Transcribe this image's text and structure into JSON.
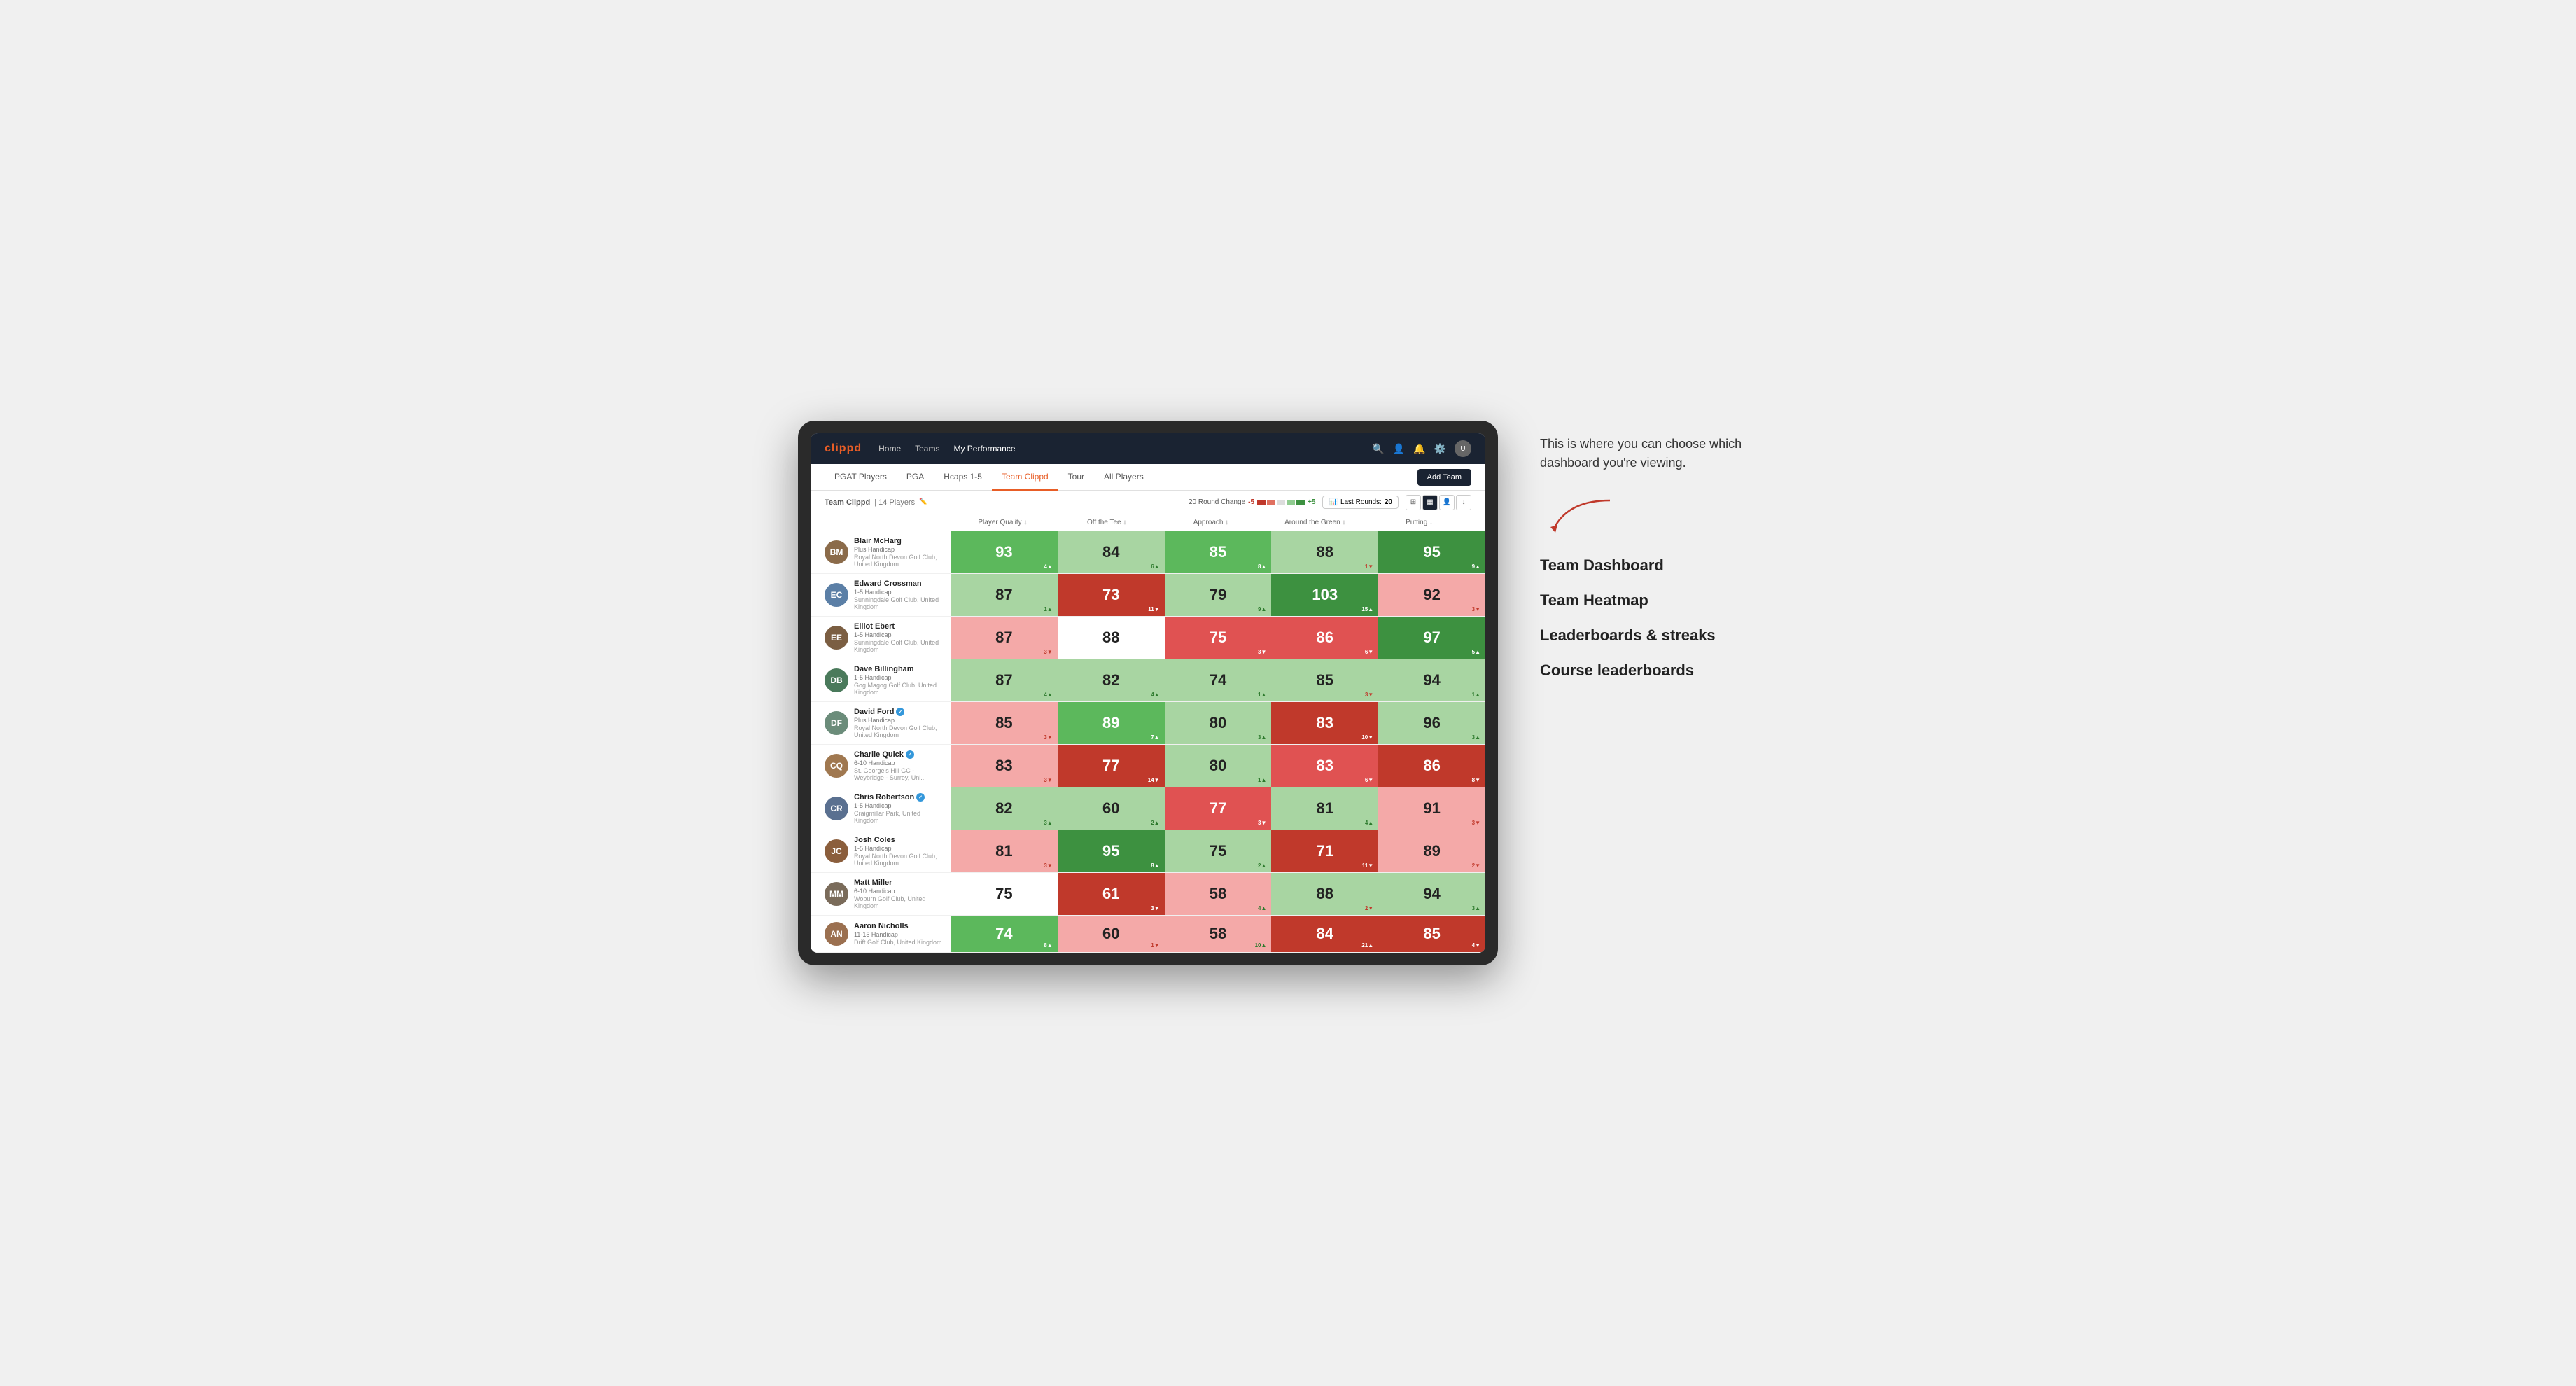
{
  "page": {
    "title": "Team Dashboard"
  },
  "nav": {
    "logo": "clippd",
    "links": [
      "Home",
      "Teams",
      "My Performance"
    ],
    "active_link": "My Performance"
  },
  "tabs": {
    "items": [
      "PGAT Players",
      "PGA",
      "Hcaps 1-5",
      "Team Clippd",
      "Tour",
      "All Players"
    ],
    "active": "Team Clippd",
    "add_button": "Add Team"
  },
  "sub_header": {
    "title": "Team Clippd",
    "player_count": "14 Players",
    "round_change_label": "20 Round Change",
    "round_change_neg": "-5",
    "round_change_pos": "+5",
    "last_rounds_label": "Last Rounds:",
    "last_rounds_value": "20"
  },
  "table": {
    "columns": [
      "Player Quality ↓",
      "Off the Tee ↓",
      "Approach ↓",
      "Around the Green ↓",
      "Putting ↓"
    ],
    "rows": [
      {
        "name": "Blair McHarg",
        "handicap": "Plus Handicap",
        "club": "Royal North Devon Golf Club, United Kingdom",
        "verified": false,
        "initials": "BM",
        "avatar_color": "#8B6B4A",
        "scores": [
          {
            "value": 93,
            "delta": 4,
            "dir": "up",
            "bg": "medium-green"
          },
          {
            "value": 84,
            "delta": 6,
            "dir": "up",
            "bg": "light-green"
          },
          {
            "value": 85,
            "delta": 8,
            "dir": "up",
            "bg": "medium-green"
          },
          {
            "value": 88,
            "delta": 1,
            "dir": "down",
            "bg": "light-green"
          },
          {
            "value": 95,
            "delta": 9,
            "dir": "up",
            "bg": "dark-green"
          }
        ]
      },
      {
        "name": "Edward Crossman",
        "handicap": "1-5 Handicap",
        "club": "Sunningdale Golf Club, United Kingdom",
        "verified": false,
        "initials": "EC",
        "avatar_color": "#5B7FA6",
        "scores": [
          {
            "value": 87,
            "delta": 1,
            "dir": "up",
            "bg": "light-green"
          },
          {
            "value": 73,
            "delta": 11,
            "dir": "down",
            "bg": "dark-red"
          },
          {
            "value": 79,
            "delta": 9,
            "dir": "up",
            "bg": "light-green"
          },
          {
            "value": 103,
            "delta": 15,
            "dir": "up",
            "bg": "dark-green"
          },
          {
            "value": 92,
            "delta": 3,
            "dir": "down",
            "bg": "light-red"
          }
        ]
      },
      {
        "name": "Elliot Ebert",
        "handicap": "1-5 Handicap",
        "club": "Sunningdale Golf Club, United Kingdom",
        "verified": false,
        "initials": "EE",
        "avatar_color": "#7B5E42",
        "scores": [
          {
            "value": 87,
            "delta": 3,
            "dir": "down",
            "bg": "light-red"
          },
          {
            "value": 88,
            "delta": null,
            "dir": null,
            "bg": "white-bg"
          },
          {
            "value": 75,
            "delta": 3,
            "dir": "down",
            "bg": "medium-red"
          },
          {
            "value": 86,
            "delta": 6,
            "dir": "down",
            "bg": "medium-red"
          },
          {
            "value": 97,
            "delta": 5,
            "dir": "up",
            "bg": "dark-green"
          }
        ]
      },
      {
        "name": "Dave Billingham",
        "handicap": "1-5 Handicap",
        "club": "Gog Magog Golf Club, United Kingdom",
        "verified": false,
        "initials": "DB",
        "avatar_color": "#4A7A5B",
        "scores": [
          {
            "value": 87,
            "delta": 4,
            "dir": "up",
            "bg": "light-green"
          },
          {
            "value": 82,
            "delta": 4,
            "dir": "up",
            "bg": "light-green"
          },
          {
            "value": 74,
            "delta": 1,
            "dir": "up",
            "bg": "light-green"
          },
          {
            "value": 85,
            "delta": 3,
            "dir": "down",
            "bg": "light-green"
          },
          {
            "value": 94,
            "delta": 1,
            "dir": "up",
            "bg": "light-green"
          }
        ]
      },
      {
        "name": "David Ford",
        "handicap": "Plus Handicap",
        "club": "Royal North Devon Golf Club, United Kingdom",
        "verified": true,
        "initials": "DF",
        "avatar_color": "#6B8C7A",
        "scores": [
          {
            "value": 85,
            "delta": 3,
            "dir": "down",
            "bg": "light-red"
          },
          {
            "value": 89,
            "delta": 7,
            "dir": "up",
            "bg": "medium-green"
          },
          {
            "value": 80,
            "delta": 3,
            "dir": "up",
            "bg": "light-green"
          },
          {
            "value": 83,
            "delta": 10,
            "dir": "down",
            "bg": "dark-red"
          },
          {
            "value": 96,
            "delta": 3,
            "dir": "up",
            "bg": "light-green"
          }
        ]
      },
      {
        "name": "Charlie Quick",
        "handicap": "6-10 Handicap",
        "club": "St. George's Hill GC - Weybridge - Surrey, Uni...",
        "verified": true,
        "initials": "CQ",
        "avatar_color": "#A07850",
        "scores": [
          {
            "value": 83,
            "delta": 3,
            "dir": "down",
            "bg": "light-red"
          },
          {
            "value": 77,
            "delta": 14,
            "dir": "down",
            "bg": "dark-red"
          },
          {
            "value": 80,
            "delta": 1,
            "dir": "up",
            "bg": "light-green"
          },
          {
            "value": 83,
            "delta": 6,
            "dir": "down",
            "bg": "medium-red"
          },
          {
            "value": 86,
            "delta": 8,
            "dir": "down",
            "bg": "dark-red"
          }
        ]
      },
      {
        "name": "Chris Robertson",
        "handicap": "1-5 Handicap",
        "club": "Craigmillar Park, United Kingdom",
        "verified": true,
        "initials": "CR",
        "avatar_color": "#5A7090",
        "scores": [
          {
            "value": 82,
            "delta": 3,
            "dir": "up",
            "bg": "light-green"
          },
          {
            "value": 60,
            "delta": 2,
            "dir": "up",
            "bg": "light-green"
          },
          {
            "value": 77,
            "delta": 3,
            "dir": "down",
            "bg": "medium-red"
          },
          {
            "value": 81,
            "delta": 4,
            "dir": "up",
            "bg": "light-green"
          },
          {
            "value": 91,
            "delta": 3,
            "dir": "down",
            "bg": "light-red"
          }
        ]
      },
      {
        "name": "Josh Coles",
        "handicap": "1-5 Handicap",
        "club": "Royal North Devon Golf Club, United Kingdom",
        "verified": false,
        "initials": "JC",
        "avatar_color": "#8B5E3C",
        "scores": [
          {
            "value": 81,
            "delta": 3,
            "dir": "down",
            "bg": "light-red"
          },
          {
            "value": 95,
            "delta": 8,
            "dir": "up",
            "bg": "dark-green"
          },
          {
            "value": 75,
            "delta": 2,
            "dir": "up",
            "bg": "light-green"
          },
          {
            "value": 71,
            "delta": 11,
            "dir": "down",
            "bg": "dark-red"
          },
          {
            "value": 89,
            "delta": 2,
            "dir": "down",
            "bg": "light-red"
          }
        ]
      },
      {
        "name": "Matt Miller",
        "handicap": "6-10 Handicap",
        "club": "Woburn Golf Club, United Kingdom",
        "verified": false,
        "initials": "MM",
        "avatar_color": "#7A6B5A",
        "scores": [
          {
            "value": 75,
            "delta": null,
            "dir": null,
            "bg": "white-bg"
          },
          {
            "value": 61,
            "delta": 3,
            "dir": "down",
            "bg": "dark-red"
          },
          {
            "value": 58,
            "delta": 4,
            "dir": "up",
            "bg": "light-red"
          },
          {
            "value": 88,
            "delta": 2,
            "dir": "down",
            "bg": "light-green"
          },
          {
            "value": 94,
            "delta": 3,
            "dir": "up",
            "bg": "light-green"
          }
        ]
      },
      {
        "name": "Aaron Nicholls",
        "handicap": "11-15 Handicap",
        "club": "Drift Golf Club, United Kingdom",
        "verified": false,
        "initials": "AN",
        "avatar_color": "#9B7050",
        "scores": [
          {
            "value": 74,
            "delta": 8,
            "dir": "up",
            "bg": "medium-green"
          },
          {
            "value": 60,
            "delta": 1,
            "dir": "down",
            "bg": "light-red"
          },
          {
            "value": 58,
            "delta": 10,
            "dir": "up",
            "bg": "light-red"
          },
          {
            "value": 84,
            "delta": 21,
            "dir": "up",
            "bg": "dark-red"
          },
          {
            "value": 85,
            "delta": 4,
            "dir": "down",
            "bg": "dark-red"
          }
        ]
      }
    ]
  },
  "sidebar": {
    "tooltip": "This is where you can choose which dashboard you're viewing.",
    "options": [
      "Team Dashboard",
      "Team Heatmap",
      "Leaderboards & streaks",
      "Course leaderboards"
    ]
  }
}
